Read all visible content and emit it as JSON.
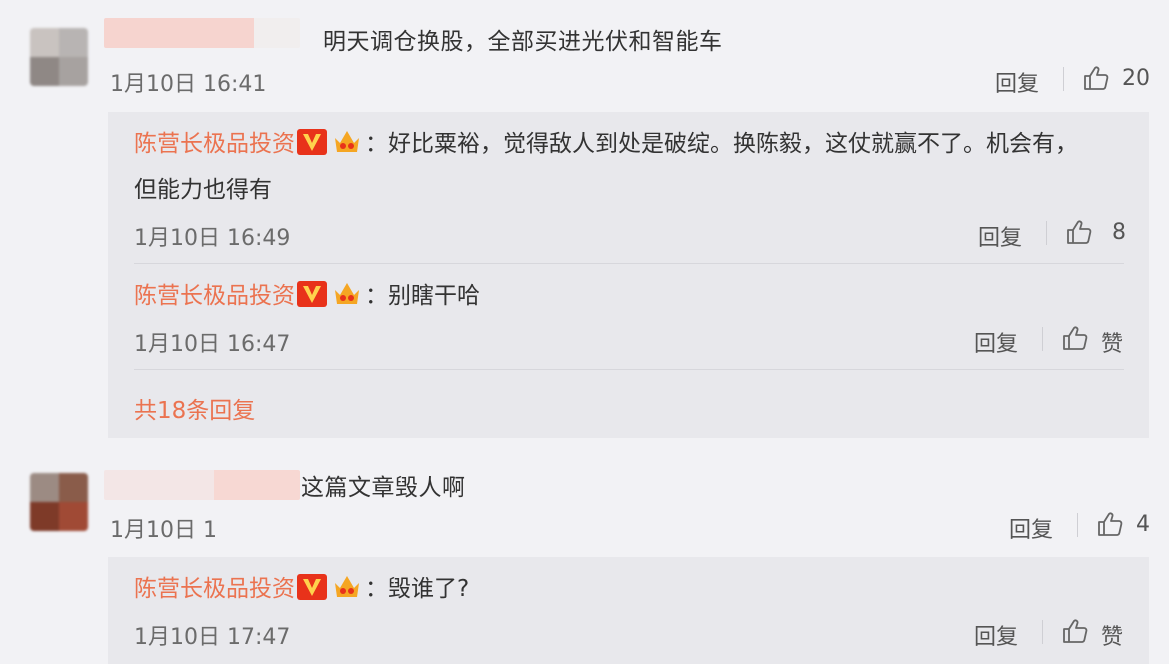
{
  "comments": [
    {
      "text": "明天调仓换股，全部买进光伏和智能车",
      "time": "1月10日 16:41",
      "reply_label": "回复",
      "likes": "20",
      "replies": [
        {
          "author": "陈营长极品投资",
          "sep": "：",
          "text": "好比粟裕，觉得敌人到处是破绽。换陈毅，这仗就赢不了。机会有，",
          "text2": "但能力也得有",
          "time": "1月10日 16:49",
          "reply_label": "回复",
          "likes": "8"
        },
        {
          "author": "陈营长极品投资",
          "sep": "：",
          "text": "别瞎干哈",
          "time": "1月10日 16:47",
          "reply_label": "回复",
          "likes": "赞"
        }
      ],
      "more_replies": "共18条回复"
    },
    {
      "text": "这篇文章毁人啊",
      "time": "1月10日 1",
      "reply_label": "回复",
      "likes": "4",
      "replies": [
        {
          "author": "陈营长极品投资",
          "sep": "：",
          "text": "毁谁了?",
          "time": "1月10日 17:47",
          "reply_label": "回复",
          "likes": "赞"
        }
      ]
    }
  ],
  "icons": {
    "like": "thumbs-up-icon",
    "verified": "verified-v-badge-icon",
    "member": "crown-member-icon"
  },
  "colors": {
    "author": "#eb7350",
    "badge": "#e8321a",
    "crown": "#f5a623",
    "background": "#f2f2f5",
    "reply_background": "#e8e8ec"
  }
}
